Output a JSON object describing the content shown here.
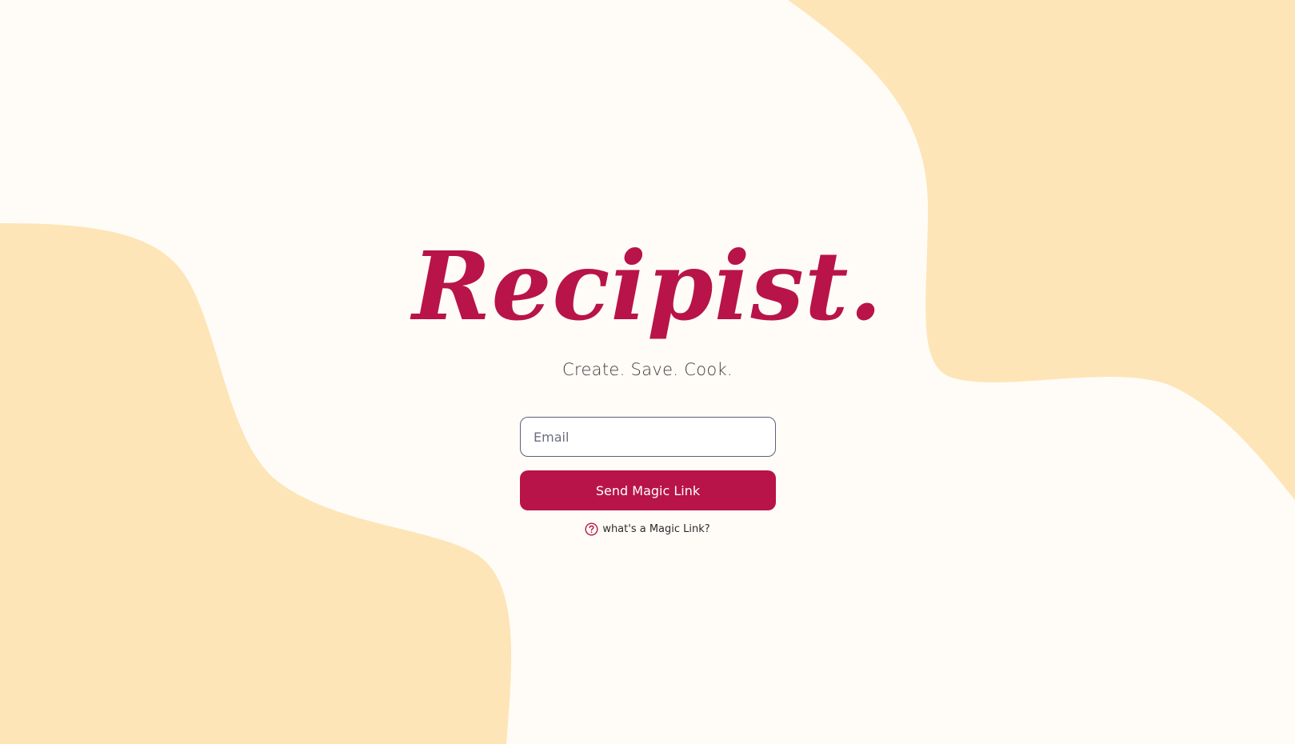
{
  "brand": {
    "logo_text": "Recipist.",
    "tagline": "Create. Save. Cook."
  },
  "login_form": {
    "email_placeholder": "Email",
    "email_value": "",
    "submit_label": "Send Magic Link",
    "help_link_label": "what's a Magic Link?",
    "help_icon": "question-circle-icon"
  },
  "colors": {
    "background": "#fffcf7",
    "blob": "#fde5b7",
    "accent": "#b81449",
    "input_border": "#5d6081"
  }
}
